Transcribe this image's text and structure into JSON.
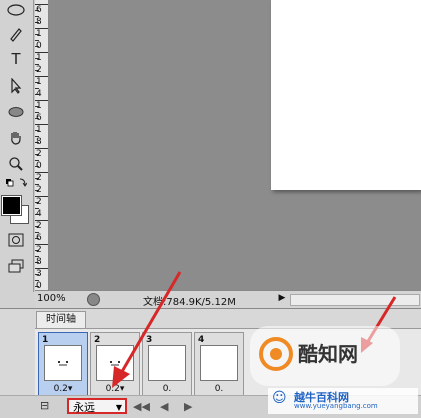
{
  "ruler": {
    "labels": [
      "6",
      "8",
      "1",
      "0",
      "1",
      "2",
      "1",
      "4",
      "1",
      "6",
      "1",
      "8",
      "2",
      "0",
      "2",
      "2",
      "2",
      "4",
      "2",
      "6",
      "2",
      "8",
      "3",
      "0"
    ]
  },
  "status": {
    "zoom": "100%",
    "doc_info": "文档:784.9K/5.12M"
  },
  "timeline": {
    "tab_label": "时间轴",
    "frames": [
      {
        "number": "1",
        "delay": "0.2▾",
        "selected": true
      },
      {
        "number": "2",
        "delay": "0.2▾",
        "selected": false
      },
      {
        "number": "3",
        "delay": "0.",
        "selected": false
      },
      {
        "number": "4",
        "delay": "0.",
        "selected": false
      }
    ],
    "loop_value": "永远"
  },
  "colors": {
    "foreground": "#000000",
    "background": "#ffffff",
    "annotation_red": "#d62828"
  },
  "watermark": {
    "text_main": "酷知网",
    "text_cn": "越牛百科网",
    "url": "www.yueyangbang.com"
  }
}
